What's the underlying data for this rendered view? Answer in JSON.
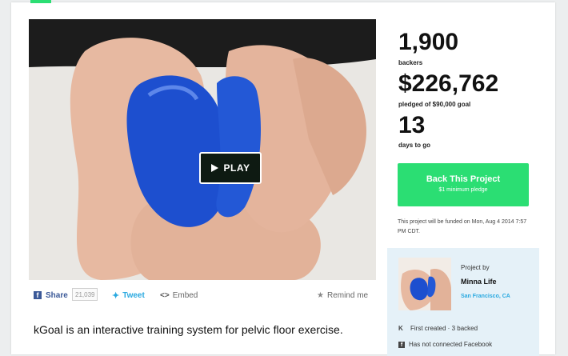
{
  "stats": {
    "backers_count": "1,900",
    "backers_label": "backers",
    "pledged_amount": "$226,762",
    "pledged_label": "pledged of $90,000 goal",
    "days_count": "13",
    "days_label": "days to go"
  },
  "cta": {
    "title": "Back This Project",
    "subtitle": "$1 minimum pledge"
  },
  "funding_note": "This project will be funded on Mon, Aug 4 2014 7:57 PM CDT.",
  "video": {
    "play_label": "PLAY"
  },
  "share_bar": {
    "share_label": "Share",
    "share_count": "21,039",
    "tweet_label": "Tweet",
    "embed_label": "Embed",
    "remind_label": "Remind me"
  },
  "blurb": "kGoal is an interactive training system for pelvic floor exercise.",
  "creator": {
    "project_by_label": "Project by",
    "name": "Minna Life",
    "location": "San Francisco, CA",
    "created_text": "First created · 3 backed",
    "facebook_text": "Has not connected Facebook"
  },
  "icons": [
    "play-icon",
    "facebook-icon",
    "twitter-icon",
    "embed-icon",
    "star-icon",
    "kickstarter-icon"
  ],
  "colors": {
    "accent_green": "#2bde73",
    "twitter_blue": "#2aa9e0",
    "facebook_blue": "#3b5998",
    "creator_panel": "#e5f1f8"
  }
}
